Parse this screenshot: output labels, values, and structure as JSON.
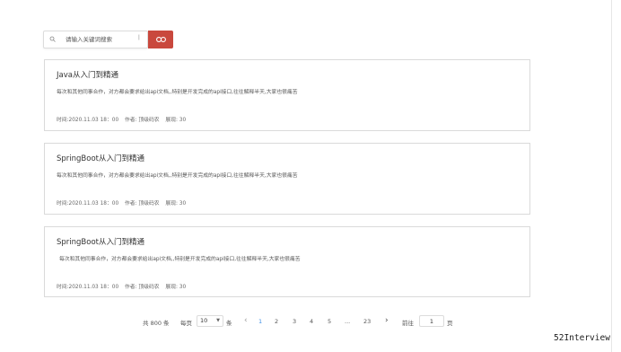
{
  "search": {
    "placeholder": "请输入关键词搜索",
    "icon": "search-icon",
    "button_icon": "link-icon",
    "button_color": "#c9483d"
  },
  "articles": [
    {
      "title": "Java从入门到精通",
      "description": "每次和其他同事合作，对方都会要求给出api文档,,特别是开发完成的api接口,往往解释半天,大家也很痛苦",
      "time": "时间:2020.11.03 18：00",
      "author": "作者: 顶级码农",
      "views": "展现: 30"
    },
    {
      "title": "SpringBoot从入门到精通",
      "description": "每次和其他同事合作，对方都会要求给出api文档,,特别是开发完成的api接口,往往解释半天,大家也很痛苦",
      "time": "时间:2020.11.03 18：00",
      "author": "作者: 顶级码农",
      "views": "展现: 30"
    },
    {
      "title": "SpringBoot从入门到精通",
      "description": "每次和其他同事合作，对方都会要求给出api文档,,特别是开发完成的api接口,往往解释半天,大家也很痛苦",
      "time": "时间:2020.11.03 18：00",
      "author": "作者: 顶级码农",
      "views": "展现: 30"
    }
  ],
  "pagination": {
    "total": "共 800 条",
    "per_page_label": "每页",
    "per_page_value": "10",
    "per_page_unit": "条",
    "pages": [
      "1",
      "2",
      "3",
      "4",
      "5",
      "...",
      "23"
    ],
    "current_page": "1",
    "goto_label": "前往",
    "goto_value": "1",
    "goto_unit": "页",
    "active_color": "#3a8ee6"
  },
  "watermark": "52Interview"
}
